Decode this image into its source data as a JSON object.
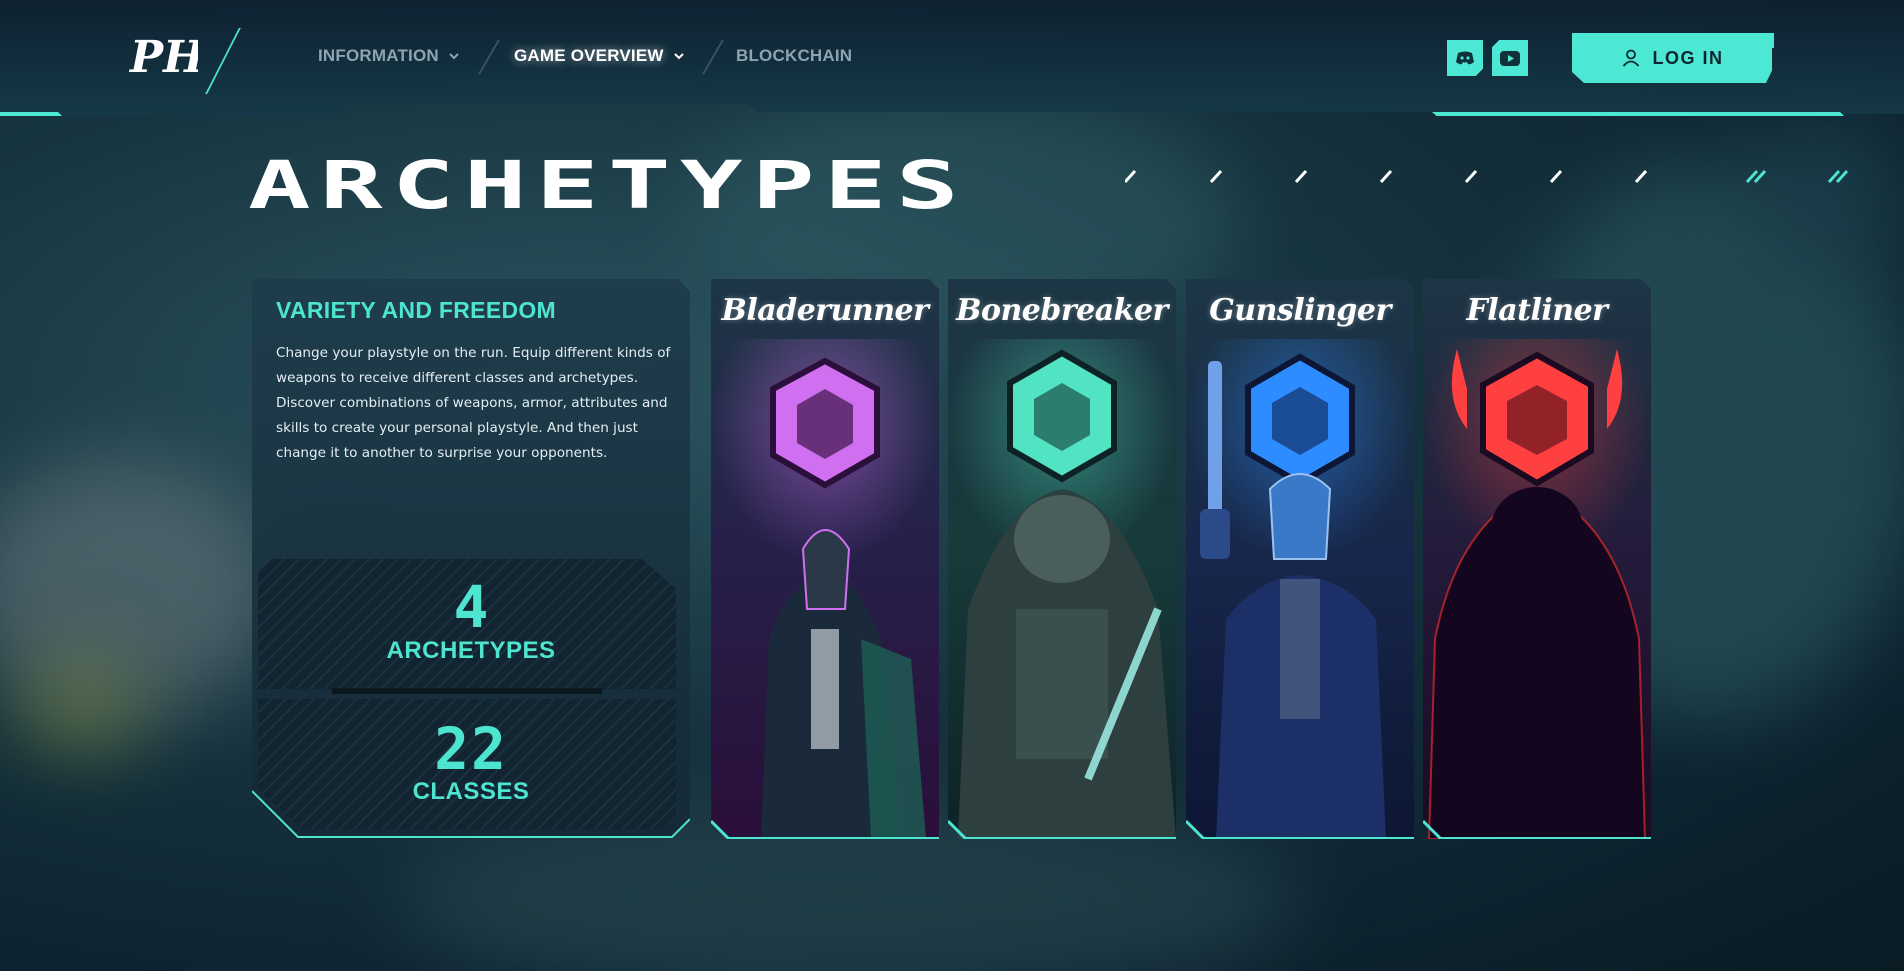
{
  "header": {
    "logo_alt": "PH",
    "nav": [
      {
        "label": "INFORMATION",
        "has_dropdown": true,
        "active": false
      },
      {
        "label": "GAME OVERVIEW",
        "has_dropdown": true,
        "active": true
      },
      {
        "label": "BLOCKCHAIN",
        "has_dropdown": false,
        "active": false
      }
    ],
    "social": [
      {
        "icon": "discord-icon"
      },
      {
        "icon": "youtube-icon"
      }
    ],
    "login_label": "LOG IN",
    "login_icon": "user-icon"
  },
  "section": {
    "title": "ARCHETYPES"
  },
  "info": {
    "heading": "VARIETY AND FREEDOM",
    "body": "Change your playstyle on the run. Equip different kinds of weapons to receive different classes and archetypes. Discover combinations of weapons, armor, attributes and skills to create your personal playstyle. And then just change it to another to surprise your opponents.",
    "stats": [
      {
        "value": "4",
        "label": "ARCHETYPES"
      },
      {
        "value": "22",
        "label": "CLASSES"
      }
    ]
  },
  "archetypes": [
    {
      "name": "Bladerunner",
      "color": "#d070f0",
      "dark": "#3a1546"
    },
    {
      "name": "Bonebreaker",
      "color": "#52e3c2",
      "dark": "#123a34"
    },
    {
      "name": "Gunslinger",
      "color": "#2d8cff",
      "dark": "#0f2150"
    },
    {
      "name": "Flatliner",
      "color": "#ff4040",
      "dark": "#3b0a14"
    }
  ],
  "colors": {
    "accent": "#4de4d0",
    "background": "#0b1c26",
    "card": "#1b3442"
  }
}
